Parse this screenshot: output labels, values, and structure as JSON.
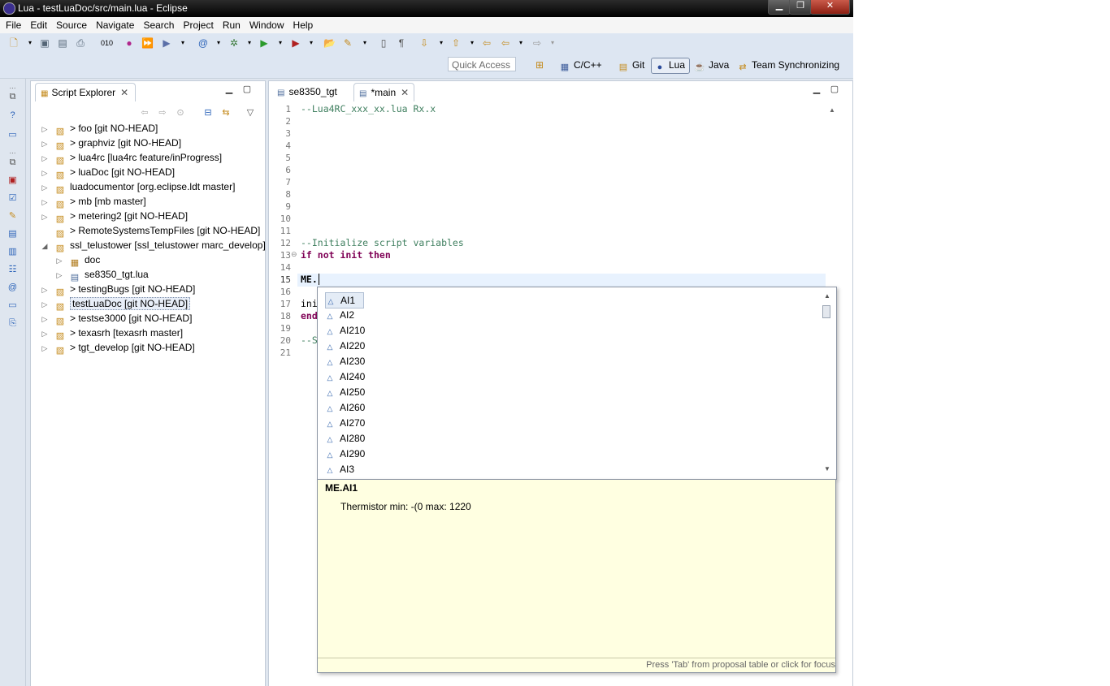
{
  "window": {
    "title": "Lua - testLuaDoc/src/main.lua - Eclipse",
    "controls": {
      "minimize": "▁",
      "maximize": "❐",
      "close": "✕"
    }
  },
  "menubar": [
    "File",
    "Edit",
    "Source",
    "Navigate",
    "Search",
    "Project",
    "Run",
    "Window",
    "Help"
  ],
  "toolbar": {
    "quick_access_placeholder": "Quick Access",
    "perspectives": [
      {
        "label": "C/C++",
        "icon": "cpp-perspective-icon",
        "active": false
      },
      {
        "label": "Git",
        "icon": "git-perspective-icon",
        "active": false
      },
      {
        "label": "Lua",
        "icon": "lua-perspective-icon",
        "active": true
      },
      {
        "label": "Java",
        "icon": "java-perspective-icon",
        "active": false
      },
      {
        "label": "Team Synchronizing",
        "icon": "team-sync-perspective-icon",
        "active": false
      }
    ]
  },
  "script_explorer": {
    "tab_label": "Script Explorer",
    "items": [
      {
        "label": "> foo  [git NO-HEAD]",
        "level": 0,
        "expanded": false,
        "selected": false
      },
      {
        "label": "> graphviz  [git NO-HEAD]",
        "level": 0,
        "expanded": false,
        "selected": false
      },
      {
        "label": "> lua4rc  [lua4rc feature/inProgress]",
        "level": 0,
        "expanded": false,
        "selected": false
      },
      {
        "label": "> luaDoc  [git NO-HEAD]",
        "level": 0,
        "expanded": false,
        "selected": false
      },
      {
        "label": "luadocumentor  [org.eclipse.ldt master]",
        "level": 0,
        "expanded": false,
        "selected": false
      },
      {
        "label": "> mb  [mb master]",
        "level": 0,
        "expanded": false,
        "selected": false
      },
      {
        "label": "> metering2  [git NO-HEAD]",
        "level": 0,
        "expanded": false,
        "selected": false
      },
      {
        "label": "> RemoteSystemsTempFiles  [git NO-HEAD]",
        "level": 0,
        "expanded": null,
        "selected": false
      },
      {
        "label": "ssl_telustower  [ssl_telustower marc_develop]",
        "level": 0,
        "expanded": true,
        "selected": false
      },
      {
        "label": "doc",
        "level": 1,
        "expanded": false,
        "selected": false
      },
      {
        "label": "se8350_tgt.lua",
        "level": 1,
        "expanded": false,
        "selected": false
      },
      {
        "label": "> testingBugs  [git NO-HEAD]",
        "level": 0,
        "expanded": false,
        "selected": false
      },
      {
        "label": "testLuaDoc  [git NO-HEAD]",
        "level": 0,
        "expanded": false,
        "selected": true
      },
      {
        "label": "> testse3000  [git NO-HEAD]",
        "level": 0,
        "expanded": false,
        "selected": false
      },
      {
        "label": "> texasrh  [texasrh master]",
        "level": 0,
        "expanded": false,
        "selected": false
      },
      {
        "label": "> tgt_develop  [git NO-HEAD]",
        "level": 0,
        "expanded": false,
        "selected": false
      }
    ]
  },
  "editor": {
    "tabs": [
      {
        "label": "se8350_tgt",
        "active": false
      },
      {
        "label": "*main",
        "active": true
      }
    ],
    "current_line": 15,
    "lines": [
      {
        "n": "1",
        "text": "--Lua4RC_xxx_xx.lua Rx.x"
      },
      {
        "n": "2",
        "text": ""
      },
      {
        "n": "3",
        "text": ""
      },
      {
        "n": "4",
        "text": ""
      },
      {
        "n": "5",
        "text": ""
      },
      {
        "n": "6",
        "text": ""
      },
      {
        "n": "7",
        "text": ""
      },
      {
        "n": "8",
        "text": ""
      },
      {
        "n": "9",
        "text": ""
      },
      {
        "n": "10",
        "text": ""
      },
      {
        "n": "11",
        "text": ""
      },
      {
        "n": "12",
        "text": "--Initialize script variables"
      },
      {
        "n": "13",
        "text": "if not init then"
      },
      {
        "n": "14",
        "text": ""
      },
      {
        "n": "15",
        "text": "ME."
      },
      {
        "n": "16",
        "text": ""
      },
      {
        "n": "17",
        "text": "ini"
      },
      {
        "n": "18",
        "text": "end"
      },
      {
        "n": "19",
        "text": ""
      },
      {
        "n": "20",
        "text": "--S"
      },
      {
        "n": "21",
        "text": ""
      }
    ]
  },
  "completion": {
    "items": [
      "AI1",
      "AI2",
      "AI210",
      "AI220",
      "AI230",
      "AI240",
      "AI250",
      "AI260",
      "AI270",
      "AI280",
      "AI290",
      "AI3"
    ],
    "selected_index": 0,
    "info_title": "ME.AI1",
    "info_description": "Thermistor min: -(0 max: 1220",
    "info_footer": "Press 'Tab' from proposal table or click for focus"
  }
}
